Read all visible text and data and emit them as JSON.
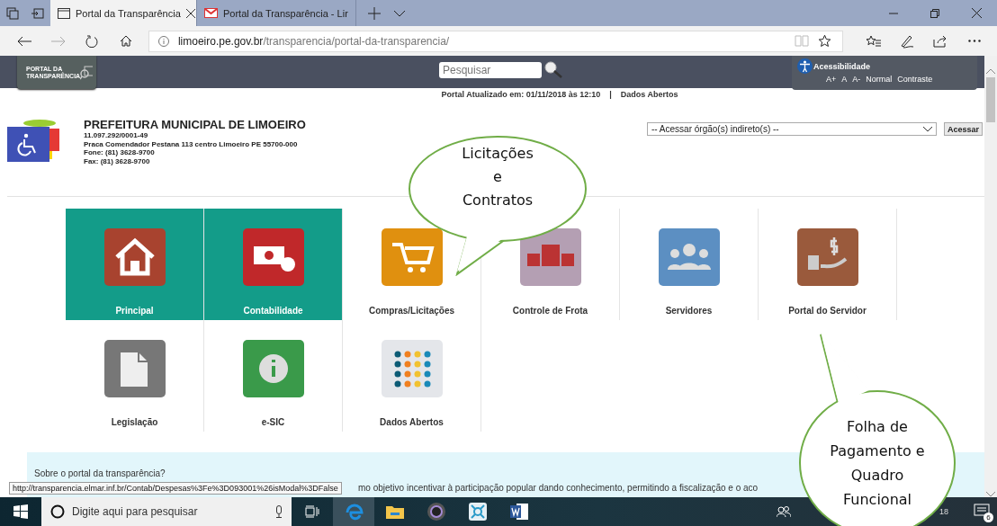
{
  "browser": {
    "tabs": [
      {
        "title": "Portal da Transparência",
        "selected": true
      },
      {
        "title": "Portal da Transparência - Lir",
        "selected": false
      }
    ],
    "address": {
      "host": "limoeiro.pe.gov.br",
      "path": "/transparencia/portal-da-transparencia/"
    }
  },
  "site_header": {
    "logo": "PORTAL DA TRANSPARÊNCIA",
    "search": {
      "placeholder": "Pesquisar"
    },
    "accessibility": {
      "title": "Acessibilidade",
      "options": [
        "A+",
        "A",
        "A-",
        "Normal",
        "Contraste"
      ]
    }
  },
  "update_bar": {
    "updated": "Portal Atualizado em: 01/11/2018 às 12:10",
    "separator": "|",
    "link": "Dados Abertos"
  },
  "municipality": {
    "name": "PREFEITURA MUNICIPAL DE LIMOEIRO",
    "lines": [
      "11.097.292/0001-49",
      "Praca Comendador Pestana 113 centro Limoeiro PE 55700-000",
      "Fone: (81) 3628-9700",
      "Fax: (81) 3628-9700"
    ],
    "select": "-- Acessar órgão(s) indireto(s) --",
    "button": "Acessar"
  },
  "tiles": [
    [
      {
        "label": "Principal",
        "selected": true
      },
      {
        "label": "Contabilidade",
        "selected": true
      },
      {
        "label": "Compras/Licitações",
        "selected": false
      },
      {
        "label": "Controle de Frota",
        "selected": false
      },
      {
        "label": "Servidores",
        "selected": false
      },
      {
        "label": "Portal do Servidor",
        "selected": false
      }
    ],
    [
      {
        "label": "Legislação",
        "selected": false
      },
      {
        "label": "e-SIC",
        "selected": false
      },
      {
        "label": "Dados Abertos",
        "selected": false
      }
    ]
  ],
  "about": {
    "title": "Sobre o portal da transparência?",
    "text": "mo objetivo incentivar à participação popular dando conhecimento, permitindo a fiscalização e o aco"
  },
  "status_tooltip": "http://transparencia.elmar.inf.br/Contab/Despesas%3Fe%3D093001%26isModal%3DFalse",
  "callouts": [
    {
      "lines": [
        "Licitações",
        "e",
        "Contratos"
      ]
    },
    {
      "lines": [
        "Folha de",
        "Pagamento e",
        "Quadro",
        "Funcional"
      ]
    }
  ],
  "taskbar": {
    "search": {
      "placeholder": "Digite aqui para pesquisar"
    },
    "clock": "18",
    "notifications": "6"
  }
}
